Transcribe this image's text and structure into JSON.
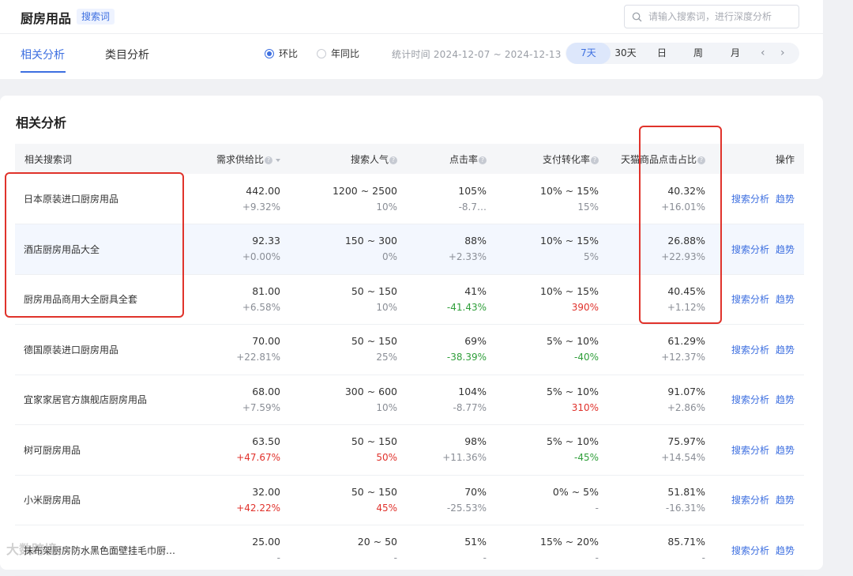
{
  "header": {
    "title": "厨房用品",
    "badge": "搜索词",
    "search_placeholder": "请输入搜索词，进行深度分析",
    "tabs": [
      {
        "label": "相关分析",
        "active": true
      },
      {
        "label": "类目分析",
        "active": false
      }
    ],
    "compare_options": [
      {
        "label": "环比",
        "selected": true
      },
      {
        "label": "年同比",
        "selected": false
      }
    ],
    "stat_time": "统计时间 2024-12-07 ~ 2024-12-13",
    "periods": [
      {
        "label": "7天",
        "active": true
      },
      {
        "label": "30天",
        "active": false
      },
      {
        "label": "日",
        "active": false
      },
      {
        "label": "周",
        "active": false
      },
      {
        "label": "月",
        "active": false
      }
    ],
    "prev_arrow": "‹",
    "next_arrow": "›"
  },
  "section": {
    "title": "相关分析",
    "columns": [
      "相关搜索词",
      "需求供给比",
      "搜索人气",
      "点击率",
      "支付转化率",
      "天猫商品点击占比",
      "操作"
    ],
    "op_labels": {
      "analysis": "搜索分析",
      "trend": "趋势"
    },
    "rows": [
      {
        "keyword": "日本原装进口厨房用品",
        "ratio": "442.00",
        "ratio_chg": "+9.32%",
        "ratio_chg_color": "gray",
        "pop": "1200 ~ 2500",
        "pop_chg": "10%",
        "pop_chg_color": "gray",
        "ctr": "105%",
        "ctr_chg": "-8.7…",
        "ctr_chg_color": "gray",
        "cvr": "10% ~ 15%",
        "cvr_chg": "15%",
        "cvr_chg_color": "gray",
        "tmall": "40.32%",
        "tmall_chg": "+16.01%",
        "tmall_chg_color": "gray"
      },
      {
        "keyword": "酒店厨房用品大全",
        "ratio": "92.33",
        "ratio_chg": "+0.00%",
        "ratio_chg_color": "gray",
        "pop": "150 ~ 300",
        "pop_chg": "0%",
        "pop_chg_color": "gray",
        "ctr": "88%",
        "ctr_chg": "+2.33%",
        "ctr_chg_color": "gray",
        "cvr": "10% ~ 15%",
        "cvr_chg": "5%",
        "cvr_chg_color": "gray",
        "tmall": "26.88%",
        "tmall_chg": "+22.93%",
        "tmall_chg_color": "gray",
        "highlight": true
      },
      {
        "keyword": "厨房用品商用大全厨具全套",
        "ratio": "81.00",
        "ratio_chg": "+6.58%",
        "ratio_chg_color": "gray",
        "pop": "50 ~ 150",
        "pop_chg": "10%",
        "pop_chg_color": "gray",
        "ctr": "41%",
        "ctr_chg": "-41.43%",
        "ctr_chg_color": "green",
        "cvr": "10% ~ 15%",
        "cvr_chg": "390%",
        "cvr_chg_color": "red",
        "tmall": "40.45%",
        "tmall_chg": "+1.12%",
        "tmall_chg_color": "gray"
      },
      {
        "keyword": "德国原装进口厨房用品",
        "ratio": "70.00",
        "ratio_chg": "+22.81%",
        "ratio_chg_color": "gray",
        "pop": "50 ~ 150",
        "pop_chg": "25%",
        "pop_chg_color": "gray",
        "ctr": "69%",
        "ctr_chg": "-38.39%",
        "ctr_chg_color": "green",
        "cvr": "5% ~ 10%",
        "cvr_chg": "-40%",
        "cvr_chg_color": "green",
        "tmall": "61.29%",
        "tmall_chg": "+12.37%",
        "tmall_chg_color": "gray"
      },
      {
        "keyword": "宜家家居官方旗舰店厨房用品",
        "ratio": "68.00",
        "ratio_chg": "+7.59%",
        "ratio_chg_color": "gray",
        "pop": "300 ~ 600",
        "pop_chg": "10%",
        "pop_chg_color": "gray",
        "ctr": "104%",
        "ctr_chg": "-8.77%",
        "ctr_chg_color": "gray",
        "cvr": "5% ~ 10%",
        "cvr_chg": "310%",
        "cvr_chg_color": "red",
        "tmall": "91.07%",
        "tmall_chg": "+2.86%",
        "tmall_chg_color": "gray"
      },
      {
        "keyword": "树可厨房用品",
        "ratio": "63.50",
        "ratio_chg": "+47.67%",
        "ratio_chg_color": "red",
        "pop": "50 ~ 150",
        "pop_chg": "50%",
        "pop_chg_color": "red",
        "ctr": "98%",
        "ctr_chg": "+11.36%",
        "ctr_chg_color": "gray",
        "cvr": "5% ~ 10%",
        "cvr_chg": "-45%",
        "cvr_chg_color": "green",
        "tmall": "75.97%",
        "tmall_chg": "+14.54%",
        "tmall_chg_color": "gray"
      },
      {
        "keyword": "小米厨房用品",
        "ratio": "32.00",
        "ratio_chg": "+42.22%",
        "ratio_chg_color": "red",
        "pop": "50 ~ 150",
        "pop_chg": "45%",
        "pop_chg_color": "red",
        "ctr": "70%",
        "ctr_chg": "-25.53%",
        "ctr_chg_color": "gray",
        "cvr": "0% ~ 5%",
        "cvr_chg": "-",
        "cvr_chg_color": "gray",
        "tmall": "51.81%",
        "tmall_chg": "-16.31%",
        "tmall_chg_color": "gray"
      },
      {
        "keyword": "抹布架厨房防水黑色面壁挂毛巾厨…",
        "ratio": "25.00",
        "ratio_chg": "-",
        "ratio_chg_color": "gray",
        "pop": "20 ~ 50",
        "pop_chg": "-",
        "pop_chg_color": "gray",
        "ctr": "51%",
        "ctr_chg": "-",
        "ctr_chg_color": "gray",
        "cvr": "15% ~ 20%",
        "cvr_chg": "-",
        "cvr_chg_color": "gray",
        "tmall": "85.71%",
        "tmall_chg": "-",
        "tmall_chg_color": "gray"
      }
    ]
  },
  "watermark": "大数跨境",
  "colors": {
    "accent": "#3d6fe0",
    "up": "#e0322c",
    "down": "#2f9e3a",
    "annotation": "#e0332b"
  }
}
